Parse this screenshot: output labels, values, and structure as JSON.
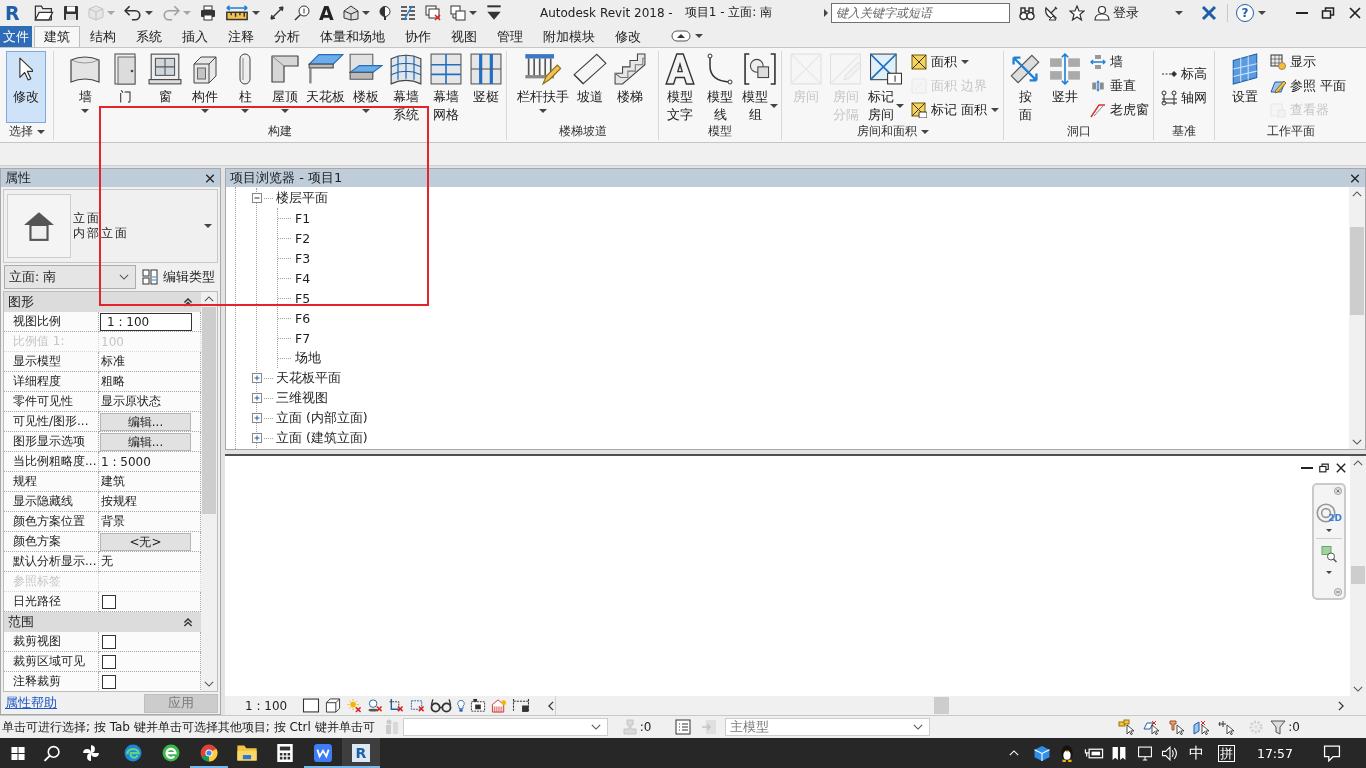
{
  "window": {
    "logo": "R",
    "title_app": "Autodesk Revit 2018 -",
    "title_doc": "项目1 - 立面: 南",
    "search_placeholder": "键入关键字或短语",
    "sign_in": "登录",
    "help": "?"
  },
  "quick_access": [
    {
      "dropdown": false,
      "disabled": false
    },
    {
      "dropdown": false,
      "disabled": false
    },
    {
      "dropdown": true,
      "disabled": true
    },
    {
      "dropdown": true,
      "disabled": false
    },
    {
      "dropdown": true,
      "disabled": true
    },
    {
      "dropdown": false,
      "disabled": false
    },
    {
      "dropdown": true,
      "disabled": false
    },
    {
      "dropdown": false,
      "disabled": false
    },
    {
      "dropdown": false,
      "disabled": false
    },
    {
      "label": "A",
      "dropdown": false,
      "disabled": false
    },
    {
      "dropdown": true,
      "disabled": false
    },
    {
      "dropdown": false,
      "disabled": false
    },
    {
      "dropdown": false,
      "disabled": false
    },
    {
      "dropdown": false,
      "disabled": false
    },
    {
      "dropdown": true,
      "disabled": false
    },
    {
      "dropdown": false,
      "disabled": false
    }
  ],
  "tabs": [
    {
      "label": "文件",
      "kind": "file",
      "selected": false
    },
    {
      "label": "建筑",
      "kind": "tab",
      "selected": true
    },
    {
      "label": "结构",
      "kind": "tab",
      "selected": false
    },
    {
      "label": "系统",
      "kind": "tab",
      "selected": false
    },
    {
      "label": "插入",
      "kind": "tab",
      "selected": false
    },
    {
      "label": "注释",
      "kind": "tab",
      "selected": false
    },
    {
      "label": "分析",
      "kind": "tab",
      "selected": false
    },
    {
      "label": "体量和场地",
      "kind": "tab",
      "selected": false
    },
    {
      "label": "协作",
      "kind": "tab",
      "selected": false
    },
    {
      "label": "视图",
      "kind": "tab",
      "selected": false
    },
    {
      "label": "管理",
      "kind": "tab",
      "selected": false
    },
    {
      "label": "附加模块",
      "kind": "tab",
      "selected": false
    },
    {
      "label": "修改",
      "kind": "tab",
      "selected": false
    }
  ],
  "ribbon_panels": [
    {
      "title": "选择",
      "menu": true,
      "tools": [
        {
          "label": "修改",
          "kind": "large",
          "selected": true,
          "disabled": false,
          "dropdown": false
        }
      ]
    },
    {
      "title": "构建",
      "menu": false,
      "tools": [
        {
          "label": "墙",
          "kind": "large",
          "selected": false,
          "disabled": false,
          "dropdown": true
        },
        {
          "label": "门",
          "kind": "large",
          "selected": false,
          "disabled": false,
          "dropdown": false
        },
        {
          "label": "窗",
          "kind": "large",
          "selected": false,
          "disabled": false,
          "dropdown": false
        },
        {
          "label": "构件",
          "kind": "large",
          "selected": false,
          "disabled": false,
          "dropdown": true
        },
        {
          "label": "柱",
          "kind": "large",
          "selected": false,
          "disabled": false,
          "dropdown": true
        },
        {
          "label": "屋顶",
          "kind": "large",
          "selected": false,
          "disabled": false,
          "dropdown": true
        },
        {
          "label": "天花板",
          "kind": "large",
          "selected": false,
          "disabled": false,
          "dropdown": false
        },
        {
          "label": "楼板",
          "kind": "large",
          "selected": false,
          "disabled": false,
          "dropdown": true
        },
        {
          "label": "幕墙系统",
          "kind": "stacked",
          "selected": false,
          "disabled": false,
          "dropdown": false
        },
        {
          "label": "幕墙网格",
          "kind": "stacked",
          "selected": false,
          "disabled": false,
          "dropdown": false
        },
        {
          "label": "竖梃",
          "kind": "large",
          "selected": false,
          "disabled": false,
          "dropdown": false
        }
      ]
    },
    {
      "title": "楼梯坡道",
      "menu": false,
      "tools": [
        {
          "label": "栏杆扶手",
          "kind": "large",
          "selected": false,
          "disabled": false,
          "dropdown": true
        },
        {
          "label": "坡道",
          "kind": "large",
          "selected": false,
          "disabled": false,
          "dropdown": false
        },
        {
          "label": "楼梯",
          "kind": "large",
          "selected": false,
          "disabled": false,
          "dropdown": false
        }
      ]
    },
    {
      "title": "模型",
      "menu": false,
      "tools": [
        {
          "label": "模型文字",
          "kind": "stacked",
          "selected": false,
          "disabled": false,
          "dropdown": false
        },
        {
          "label": "模型线",
          "kind": "stacked",
          "selected": false,
          "disabled": false,
          "dropdown": false
        },
        {
          "label": "模型组",
          "kind": "stacked",
          "selected": false,
          "disabled": false,
          "dropdown": true
        }
      ]
    },
    {
      "title": "房间和面积",
      "menu": true,
      "tools": [
        {
          "label": "房间",
          "kind": "large",
          "selected": false,
          "disabled": true,
          "dropdown": false
        },
        {
          "label": "房间分隔",
          "kind": "stacked",
          "selected": false,
          "disabled": true,
          "dropdown": false
        },
        {
          "label": "标记房间",
          "kind": "stacked",
          "selected": false,
          "disabled": false,
          "dropdown": true
        },
        {
          "label": "面积",
          "kind": "small",
          "selected": false,
          "disabled": false,
          "dropdown": true
        },
        {
          "label": "面积 边界",
          "kind": "small",
          "selected": false,
          "disabled": true,
          "dropdown": false
        },
        {
          "label": "标记 面积",
          "kind": "small",
          "selected": false,
          "disabled": false,
          "dropdown": true
        }
      ]
    },
    {
      "title": "洞口",
      "menu": false,
      "tools": [
        {
          "label": "按面",
          "kind": "stacked",
          "selected": false,
          "disabled": false,
          "dropdown": false
        },
        {
          "label": "竖井",
          "kind": "large",
          "selected": false,
          "disabled": false,
          "dropdown": false
        },
        {
          "label": "墙",
          "kind": "small",
          "selected": false,
          "disabled": false,
          "dropdown": false
        },
        {
          "label": "垂直",
          "kind": "small",
          "selected": false,
          "disabled": false,
          "dropdown": false
        },
        {
          "label": "老虎窗",
          "kind": "small",
          "selected": false,
          "disabled": false,
          "dropdown": false
        }
      ]
    },
    {
      "title": "基准",
      "menu": false,
      "tools": [
        {
          "label": "标高",
          "kind": "small",
          "selected": false,
          "disabled": false,
          "dropdown": false
        },
        {
          "label": "轴网",
          "kind": "small",
          "selected": false,
          "disabled": false,
          "dropdown": false
        }
      ]
    },
    {
      "title": "工作平面",
      "menu": false,
      "tools": [
        {
          "label": "设置",
          "kind": "large",
          "selected": false,
          "disabled": false,
          "dropdown": false
        },
        {
          "label": "显示",
          "kind": "small",
          "selected": false,
          "disabled": false,
          "dropdown": false
        },
        {
          "label": "参照 平面",
          "kind": "small",
          "selected": false,
          "disabled": false,
          "dropdown": false
        },
        {
          "label": "查看器",
          "kind": "small",
          "selected": false,
          "disabled": true,
          "dropdown": false
        }
      ]
    }
  ],
  "properties": {
    "title": "属性",
    "type_family": "立面",
    "type_name": "内部立面",
    "view_selector": "立面: 南",
    "edit_type": "编辑类型",
    "groups": [
      {
        "name": "图形",
        "expanded": true,
        "rows": [
          {
            "name": "视图比例",
            "kind": "input",
            "value": "1 : 100",
            "disabled": false
          },
          {
            "name": "比例值 1:",
            "kind": "text",
            "value": "100",
            "disabled": true
          },
          {
            "name": "显示模型",
            "kind": "text",
            "value": "标准",
            "disabled": false
          },
          {
            "name": "详细程度",
            "kind": "text",
            "value": "粗略",
            "disabled": false
          },
          {
            "name": "零件可见性",
            "kind": "text",
            "value": "显示原状态",
            "disabled": false
          },
          {
            "name": "可见性/图形...",
            "kind": "button",
            "value": "编辑...",
            "disabled": false
          },
          {
            "name": "图形显示选项",
            "kind": "button",
            "value": "编辑...",
            "disabled": false
          },
          {
            "name": "当比例粗略度...",
            "kind": "text",
            "value": "1 : 5000",
            "disabled": false
          },
          {
            "name": "规程",
            "kind": "text",
            "value": "建筑",
            "disabled": false
          },
          {
            "name": "显示隐藏线",
            "kind": "text",
            "value": "按规程",
            "disabled": false
          },
          {
            "name": "颜色方案位置",
            "kind": "text",
            "value": "背景",
            "disabled": false
          },
          {
            "name": "颜色方案",
            "kind": "button",
            "value": "<无>",
            "disabled": false
          },
          {
            "name": "默认分析显示...",
            "kind": "text",
            "value": "无",
            "disabled": false
          },
          {
            "name": "参照标签",
            "kind": "text",
            "disabled": true
          },
          {
            "name": "日光路径",
            "kind": "checkbox",
            "checked": false,
            "disabled": false
          }
        ]
      },
      {
        "name": "范围",
        "expanded": true,
        "rows": [
          {
            "name": "裁剪视图",
            "kind": "checkbox",
            "checked": false,
            "disabled": false
          },
          {
            "name": "裁剪区域可见",
            "kind": "checkbox",
            "checked": false,
            "disabled": false
          },
          {
            "name": "注释裁剪",
            "kind": "checkbox",
            "checked": false,
            "disabled": false
          }
        ]
      }
    ],
    "help": "属性帮助",
    "apply": {
      "label": "应用",
      "disabled": true
    }
  },
  "browser": {
    "title": "项目浏览器 - 项目1",
    "tree": [
      {
        "label": "楼层平面",
        "expanded": true,
        "children": [
          {
            "label": "F1"
          },
          {
            "label": "F2"
          },
          {
            "label": "F3"
          },
          {
            "label": "F4"
          },
          {
            "label": "F5"
          },
          {
            "label": "F6"
          },
          {
            "label": "F7"
          },
          {
            "label": "场地"
          }
        ]
      },
      {
        "label": "天花板平面",
        "expanded": false
      },
      {
        "label": "三维视图",
        "expanded": false
      },
      {
        "label": "立面 (内部立面)",
        "expanded": false
      },
      {
        "label": "立面 (建筑立面)",
        "expanded": false
      }
    ]
  },
  "view": {
    "wheel_label": "2D",
    "scale": "1 : 100"
  },
  "status": {
    "message": "单击可进行选择; 按 Tab 键并单击可选择其他项目; 按 Ctrl 键并单击可",
    "editable_count": ":0",
    "design_option": "主模型",
    "filter_count": ":0"
  },
  "taskbar": {
    "apps": [
      {
        "running": false,
        "selected": false
      },
      {
        "running": false,
        "selected": false
      },
      {
        "running": false,
        "selected": false
      },
      {
        "running": true,
        "selected": false
      },
      {
        "running": false,
        "selected": false
      },
      {
        "running": false,
        "selected": false
      },
      {
        "running": true,
        "selected": false
      },
      {
        "label": "R",
        "running": true,
        "selected": true
      }
    ],
    "ime": "中",
    "ime_mode": "拼",
    "time": "17:57"
  },
  "annotations": [
    {
      "kind": "rectangle"
    }
  ]
}
